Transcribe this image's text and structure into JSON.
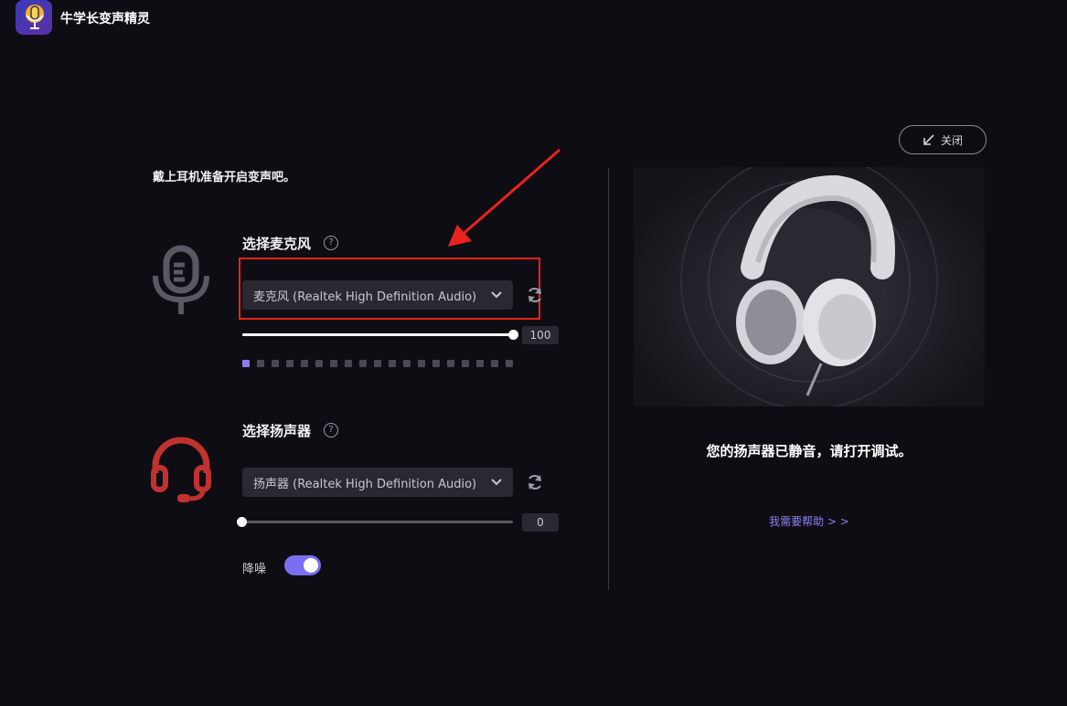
{
  "app": {
    "title": "牛学长变声精灵"
  },
  "intro_text": "戴上耳机准备开启变声吧。",
  "microphone": {
    "title": "选择麦克风",
    "help": "?",
    "device": "麦克风 (Realtek High Definition Audio)",
    "volume": "100",
    "volume_fraction": 1.0,
    "meter_levels_on": 1,
    "meter_total": 19
  },
  "speaker": {
    "title": "选择扬声器",
    "help": "?",
    "device": "扬声器 (Realtek High Definition Audio)",
    "volume": "0",
    "volume_fraction": 0.0
  },
  "noise_reduction": {
    "label": "降噪",
    "enabled": true
  },
  "close_button": {
    "label": "关闭"
  },
  "preview": {
    "muted_message": "您的扬声器已静音，请打开调试。",
    "help_link": "我需要帮助 > >"
  },
  "colors": {
    "background": "#0f0d14",
    "accent": "#8b7cf0",
    "mic_icon": "#5a5863",
    "speaker_icon": "#c0322f",
    "annotation": "#e8231e"
  },
  "icons": {
    "logo": "microphone-logo-icon",
    "mic": "microphone-icon",
    "speaker": "headset-icon",
    "refresh": "refresh-icon",
    "dropdown": "chevron-down-icon",
    "close": "arrow-down-left-icon"
  }
}
